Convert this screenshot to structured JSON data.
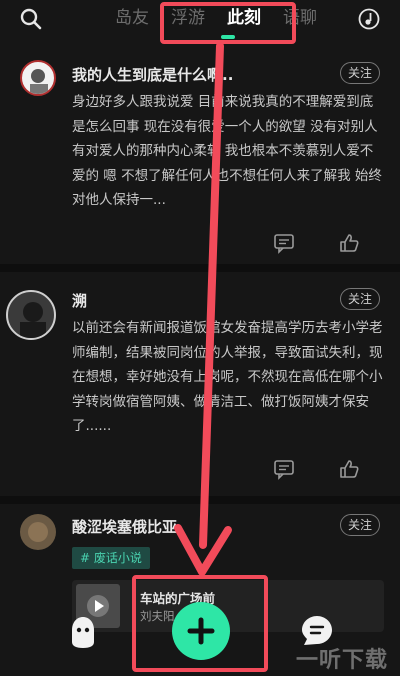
{
  "top_nav": {
    "tabs": [
      {
        "label": "岛友"
      },
      {
        "label": "浮游"
      },
      {
        "label": "此刻"
      },
      {
        "label": "语聊"
      }
    ],
    "active_tab": "此刻",
    "accent_color": "#2ee6a6"
  },
  "posts": [
    {
      "username": "我的人生到底是什么啊..",
      "follow_label": "关注",
      "text": "身边好多人跟我说爱 目前来说我真的不理解爱到底是怎么回事 现在没有很爱一个人的欲望 没有对别人有对爱人的那种内心柔软 我也根本不羡慕别人爱不爱的 嗯 不想了解任何人也不想任何人来了解我 始终对他人保持一..."
    },
    {
      "username": "溯",
      "follow_label": "关注",
      "text": "以前还会有新闻报道饭馆女发奋提高学历去考小学老师编制，结果被同岗位的人举报，导致面试失利，现在想想，幸好她没有上岗呢，不然现在高低在哪个小学转岗做宿管阿姨、做清洁工、做打饭阿姨才保安了......"
    },
    {
      "username": "酸涩埃塞俄比亚",
      "follow_label": "关注",
      "tag": "# 废话小说",
      "song_title": "车站的广场前",
      "song_artist": "刘夫阳"
    }
  ],
  "watermark": "一听下载",
  "highlight_color": "#f24b5a",
  "icons": [
    "search-icon",
    "music-note-icon",
    "comment-icon",
    "like-icon",
    "ghost-icon",
    "plus-icon",
    "chat-icon",
    "play-icon"
  ]
}
